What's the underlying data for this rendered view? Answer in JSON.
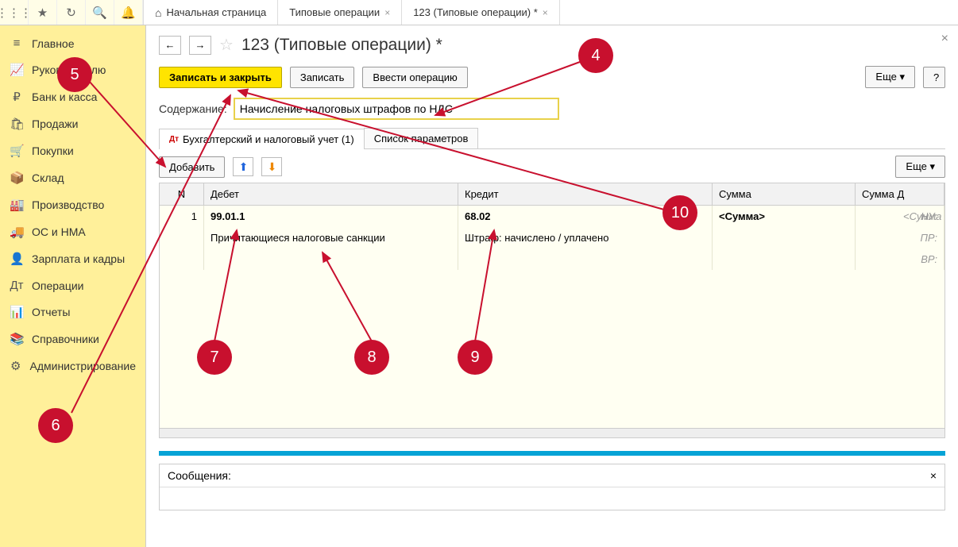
{
  "tabs": {
    "home": "Начальная страница",
    "t1": "Типовые операции",
    "t2": "123 (Типовые операции) *"
  },
  "sidebar": {
    "items": [
      {
        "icon": "≡",
        "label": "Главное"
      },
      {
        "icon": "📈",
        "label": "Руководителю"
      },
      {
        "icon": "₽",
        "label": "Банк и касса"
      },
      {
        "icon": "🛍",
        "label": "Продажи"
      },
      {
        "icon": "🛒",
        "label": "Покупки"
      },
      {
        "icon": "📦",
        "label": "Склад"
      },
      {
        "icon": "🏭",
        "label": "Производство"
      },
      {
        "icon": "🚚",
        "label": "ОС и НМА"
      },
      {
        "icon": "👤",
        "label": "Зарплата и кадры"
      },
      {
        "icon": "Дт",
        "label": "Операции"
      },
      {
        "icon": "📊",
        "label": "Отчеты"
      },
      {
        "icon": "📚",
        "label": "Справочники"
      },
      {
        "icon": "⚙",
        "label": "Администрирование"
      }
    ]
  },
  "page": {
    "title": "123 (Типовые операции) *",
    "buttons": {
      "save_close": "Записать и закрыть",
      "save": "Записать",
      "enter_op": "Ввести операцию",
      "more": "Еще",
      "help": "?"
    },
    "field_label": "Содержание:",
    "field_value": "Начисление налоговых штрафов по НДС",
    "subtabs": {
      "t1": "Бухгалтерский и налоговый учет (1)",
      "t2": "Список параметров"
    },
    "toolbar2": {
      "add": "Добавить",
      "more": "Еще"
    },
    "grid": {
      "headers": {
        "n": "N",
        "debit": "Дебет",
        "credit": "Кредит",
        "sum": "Сумма",
        "sumd": "Сумма Д"
      },
      "row": {
        "n": "1",
        "debit_acct": "99.01.1",
        "debit_desc": "Причитающиеся налоговые санкции",
        "credit_acct": "68.02",
        "credit_desc": "Штраф: начислено / уплачено",
        "sum": "<Сумма>",
        "nu": "НУ:",
        "pr": "ПР:",
        "vr": "ВР:",
        "sumd": "<Сумма"
      }
    },
    "messages_label": "Сообщения:"
  },
  "callouts": {
    "c4": "4",
    "c5": "5",
    "c6": "6",
    "c7": "7",
    "c8": "8",
    "c9": "9",
    "c10": "10"
  }
}
